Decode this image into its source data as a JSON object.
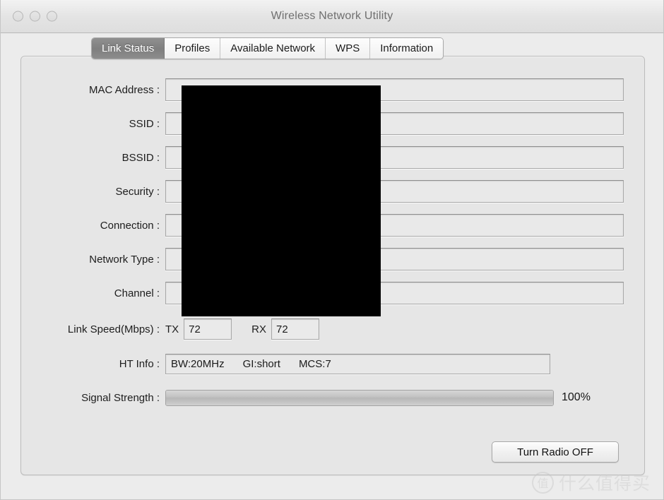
{
  "window": {
    "title": "Wireless Network Utility",
    "traffic_lights": [
      "close",
      "minimize",
      "zoom"
    ]
  },
  "tabs": [
    {
      "label": "Link Status",
      "active": true
    },
    {
      "label": "Profiles",
      "active": false
    },
    {
      "label": "Available Network",
      "active": false
    },
    {
      "label": "WPS",
      "active": false
    },
    {
      "label": "Information",
      "active": false
    }
  ],
  "fields": [
    {
      "label": "MAC Address :",
      "value": ""
    },
    {
      "label": "SSID :",
      "value": ""
    },
    {
      "label": "BSSID :",
      "value": ""
    },
    {
      "label": "Security :",
      "value": ""
    },
    {
      "label": "Connection :",
      "value": ""
    },
    {
      "label": "Network Type :",
      "value": ""
    },
    {
      "label": "Channel :",
      "value": ""
    }
  ],
  "link_speed": {
    "label": "Link Speed(Mbps) :",
    "tx_tag": "TX",
    "tx_value": "72",
    "rx_tag": "RX",
    "rx_value": "72"
  },
  "ht_info": {
    "label": "HT Info :",
    "bandwidth": "BW:20MHz",
    "guard_interval": "GI:short",
    "mcs": "MCS:7"
  },
  "signal_strength": {
    "label": "Signal Strength :",
    "percent_label": "100%",
    "percent_value": 100
  },
  "actions": {
    "radio_toggle_label": "Turn Radio OFF"
  },
  "watermark": {
    "badge": "值",
    "text": "什么值得买"
  },
  "colors": {
    "window_bg": "#ececec",
    "panel_bg": "#e6e6e6",
    "active_tab_bg": "#838383",
    "field_bg": "#e9e9e9",
    "redaction": "#000000",
    "title_text": "#6f6f6f"
  }
}
